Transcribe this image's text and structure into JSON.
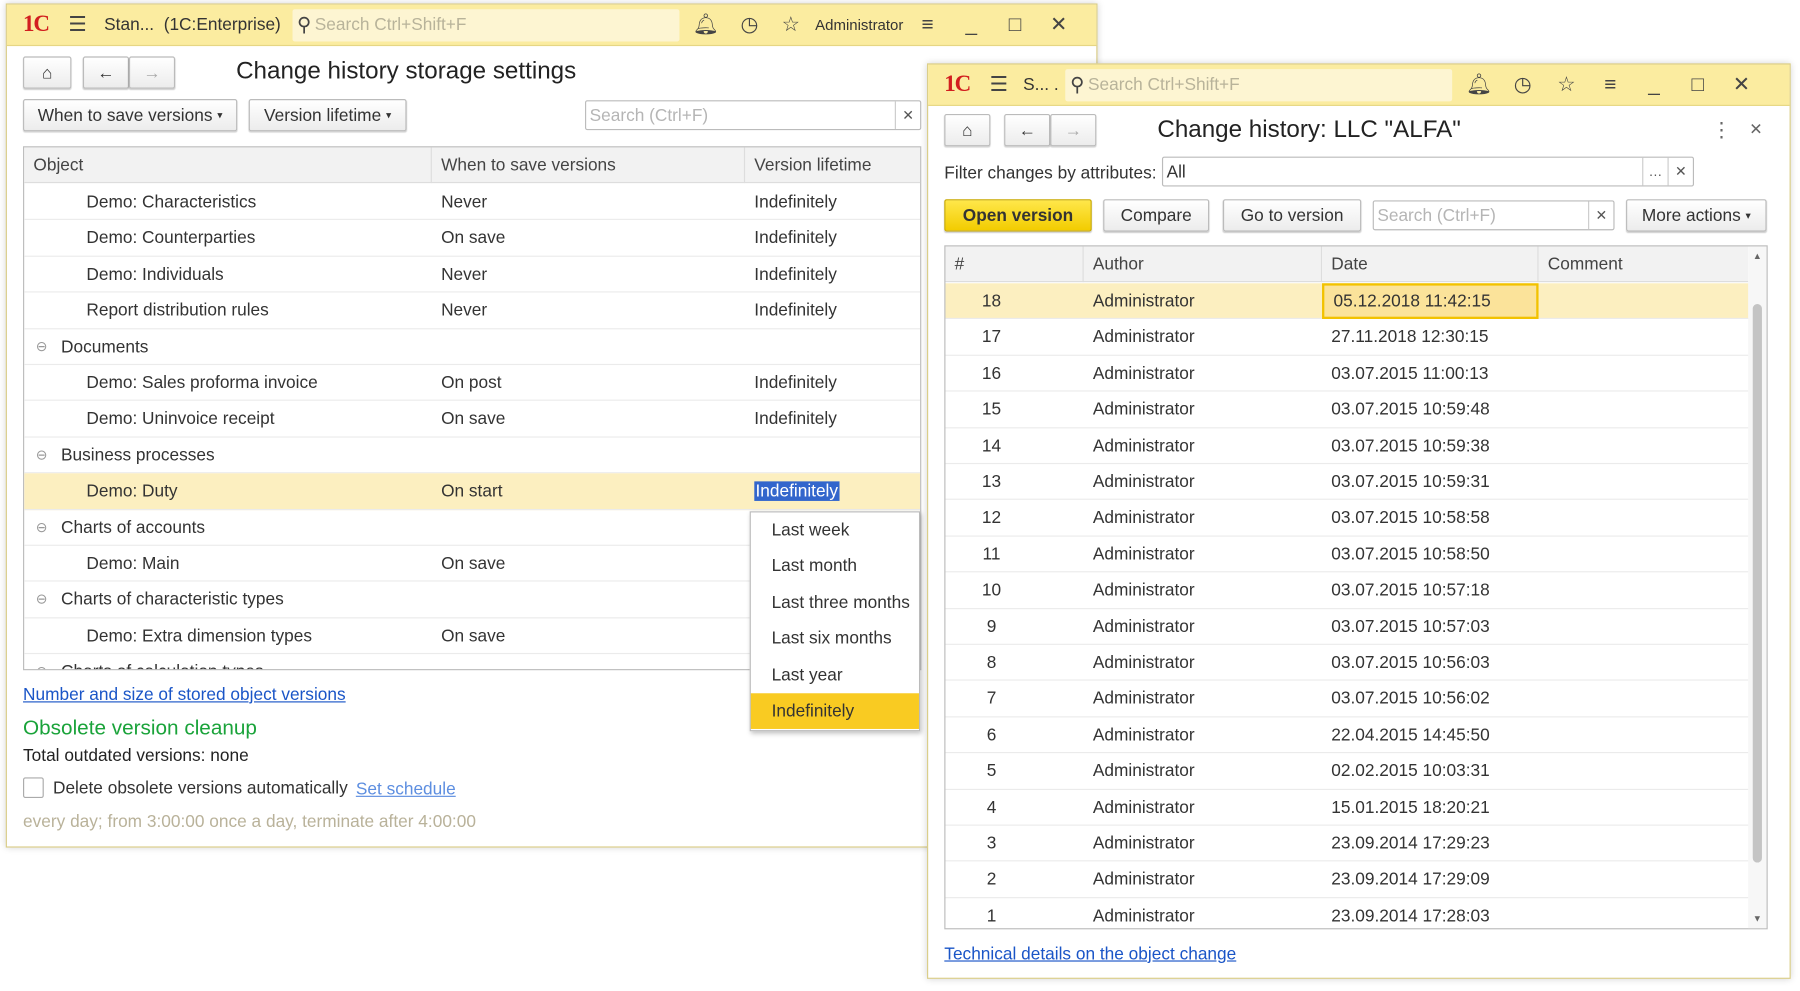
{
  "window1": {
    "titlebar": {
      "app_title": "Stan...  (1C:Enterprise)",
      "search_placeholder": "Search Ctrl+Shift+F",
      "user": "Administrator"
    },
    "title": "Change history storage settings",
    "buttons": {
      "when_to_save": "When to save versions",
      "version_lifetime": "Version lifetime"
    },
    "search_placeholder": "Search (Ctrl+F)",
    "columns": [
      "Object",
      "When to save versions",
      "Version lifetime"
    ],
    "rows": [
      {
        "object": "Demo: Characteristics",
        "when": "Never",
        "lifetime": "Indefinitely"
      },
      {
        "object": "Demo: Counterparties",
        "when": "On save",
        "lifetime": "Indefinitely"
      },
      {
        "object": "Demo: Individuals",
        "when": "Never",
        "lifetime": "Indefinitely"
      },
      {
        "object": "Report distribution rules",
        "when": "Never",
        "lifetime": "Indefinitely"
      },
      {
        "group": true,
        "object": "Documents"
      },
      {
        "object": "Demo: Sales proforma invoice",
        "when": "On post",
        "lifetime": "Indefinitely"
      },
      {
        "object": "Demo: Uninvoice receipt",
        "when": "On save",
        "lifetime": "Indefinitely"
      },
      {
        "group": true,
        "object": "Business processes"
      },
      {
        "object": "Demo: Duty",
        "when": "On start",
        "lifetime": "Indefinitely",
        "selected": true
      },
      {
        "group": true,
        "object": "Charts of accounts"
      },
      {
        "object": "Demo: Main",
        "when": "On save",
        "lifetime": ""
      },
      {
        "group": true,
        "object": "Charts of characteristic types"
      },
      {
        "object": "Demo: Extra dimension types",
        "when": "On save",
        "lifetime": ""
      },
      {
        "group": true,
        "object": "Charts of calculation types"
      }
    ],
    "lifetime_dropdown": {
      "options": [
        "Last week",
        "Last month",
        "Last three months",
        "Last six months",
        "Last year",
        "Indefinitely"
      ],
      "selected": "Indefinitely"
    },
    "stats_link": "Number and size of stored object versions",
    "cleanup_heading": "Obsolete version cleanup",
    "total_outdated": "Total outdated versions: none",
    "auto_delete_label": "Delete obsolete versions automatically",
    "auto_delete_checked": false,
    "schedule_link": "Set schedule",
    "schedule_text": "every day; from 3:00:00 once a day, terminate after 4:00:00"
  },
  "window2": {
    "titlebar": {
      "app_title": "S... .",
      "search_placeholder": "Search Ctrl+Shift+F"
    },
    "title": "Change history: LLC \"ALFA\"",
    "filter_label": "Filter changes by attributes:",
    "filter_value": "All",
    "buttons": {
      "open_version": "Open version",
      "compare": "Compare",
      "go_to_version": "Go to version",
      "more_actions": "More actions"
    },
    "search_placeholder": "Search (Ctrl+F)",
    "columns": [
      "#",
      "Author",
      "Date",
      "Comment"
    ],
    "rows": [
      {
        "n": "18",
        "author": "Administrator",
        "date": "05.12.2018 11:42:15",
        "comment": ""
      },
      {
        "n": "17",
        "author": "Administrator",
        "date": "27.11.2018 12:30:15",
        "comment": ""
      },
      {
        "n": "16",
        "author": "Administrator",
        "date": "03.07.2015 11:00:13",
        "comment": ""
      },
      {
        "n": "15",
        "author": "Administrator",
        "date": "03.07.2015 10:59:48",
        "comment": ""
      },
      {
        "n": "14",
        "author": "Administrator",
        "date": "03.07.2015 10:59:38",
        "comment": ""
      },
      {
        "n": "13",
        "author": "Administrator",
        "date": "03.07.2015 10:59:31",
        "comment": ""
      },
      {
        "n": "12",
        "author": "Administrator",
        "date": "03.07.2015 10:58:58",
        "comment": ""
      },
      {
        "n": "11",
        "author": "Administrator",
        "date": "03.07.2015 10:58:50",
        "comment": ""
      },
      {
        "n": "10",
        "author": "Administrator",
        "date": "03.07.2015 10:57:18",
        "comment": ""
      },
      {
        "n": "9",
        "author": "Administrator",
        "date": "03.07.2015 10:57:03",
        "comment": ""
      },
      {
        "n": "8",
        "author": "Administrator",
        "date": "03.07.2015 10:56:03",
        "comment": ""
      },
      {
        "n": "7",
        "author": "Administrator",
        "date": "03.07.2015 10:56:02",
        "comment": ""
      },
      {
        "n": "6",
        "author": "Administrator",
        "date": "22.04.2015 14:45:50",
        "comment": ""
      },
      {
        "n": "5",
        "author": "Administrator",
        "date": "02.02.2015 10:03:31",
        "comment": ""
      },
      {
        "n": "4",
        "author": "Administrator",
        "date": "15.01.2015 18:20:21",
        "comment": ""
      },
      {
        "n": "3",
        "author": "Administrator",
        "date": "23.09.2014 17:29:23",
        "comment": ""
      },
      {
        "n": "2",
        "author": "Administrator",
        "date": "23.09.2014 17:29:09",
        "comment": ""
      },
      {
        "n": "1",
        "author": "Administrator",
        "date": "23.09.2014 17:28:03",
        "comment": ""
      }
    ],
    "details_link": "Technical details on the object change"
  },
  "colors": {
    "titlebar": "#fbeca0",
    "accent_yellow": "#f9cb22",
    "selected_row": "#fcefc0",
    "link": "#1a55c7",
    "heading_green": "#1aa33a"
  }
}
